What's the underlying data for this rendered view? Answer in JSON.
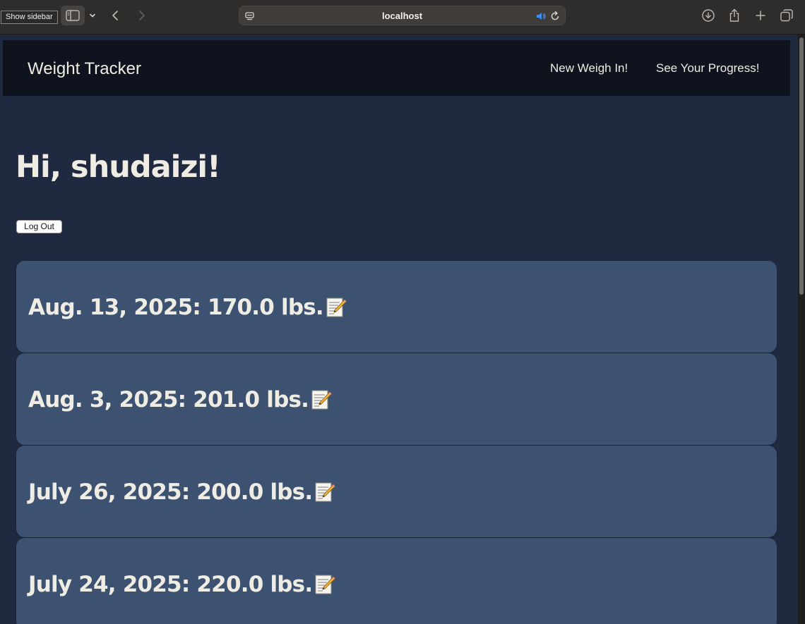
{
  "browser": {
    "tooltip": "Show sidebar",
    "url": "localhost",
    "icons": [
      "sidebar-icon",
      "chevron-down-icon",
      "back-icon",
      "forward-icon",
      "page-menu-icon",
      "speaker-icon",
      "reload-icon",
      "download-icon",
      "share-icon",
      "new-tab-icon",
      "tabs-overview-icon"
    ],
    "accent": "#3b8ef5"
  },
  "navbar": {
    "brand": "Weight Tracker",
    "links": [
      "New Weigh In!",
      "See Your Progress!"
    ]
  },
  "main": {
    "greeting": "Hi, shudaizi!",
    "logout_label": "Log Out",
    "entries": [
      {
        "label": "Aug. 13, 2025: 170.0 lbs."
      },
      {
        "label": "Aug. 3, 2025: 201.0 lbs."
      },
      {
        "label": "July 26, 2025: 200.0 lbs."
      },
      {
        "label": "July 24, 2025: 220.0 lbs."
      }
    ]
  },
  "colors": {
    "page_bg": "#1f2a40",
    "navbar_bg": "#0f131d",
    "card_bg": "#3c5270",
    "text": "#efece4"
  }
}
